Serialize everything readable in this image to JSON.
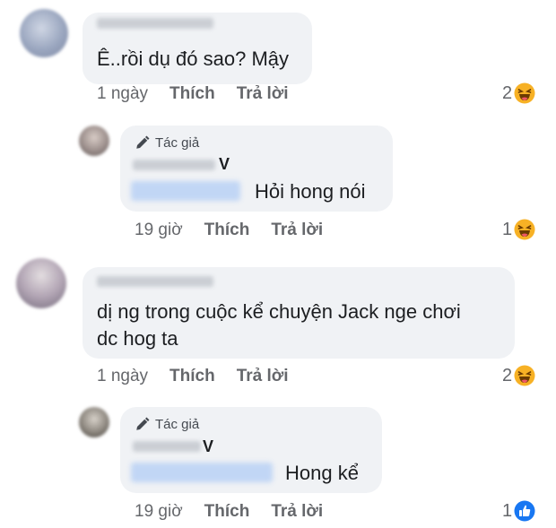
{
  "comments": [
    {
      "text": "Ê..rồi dụ đó sao? Mậy",
      "time": "1 ngày",
      "like": "Thích",
      "reply": "Trả lời",
      "reaction_count": "2",
      "reaction_icon": "haha-emoji-icon"
    },
    {
      "badge": "Tác giả",
      "name_tail": "V",
      "text": "Hỏi hong nói",
      "time": "19 giờ",
      "like": "Thích",
      "reply": "Trả lời",
      "reaction_count": "1",
      "reaction_icon": "haha-emoji-icon"
    },
    {
      "text_line1": "dị ng trong cuộc kể chuyện Jack nge chơi",
      "text_line2": "dc hog ta",
      "time": "1 ngày",
      "like": "Thích",
      "reply": "Trả lời",
      "reaction_count": "2",
      "reaction_icon": "haha-emoji-icon"
    },
    {
      "badge": "Tác giả",
      "name_tail": "V",
      "text": "Hong kể",
      "time": "19 giờ",
      "like": "Thích",
      "reply": "Trả lời",
      "reaction_count": "1",
      "reaction_icon": "like-icon"
    }
  ],
  "colors": {
    "bubble": "#f0f2f5",
    "meta_text": "#65676b",
    "haha_yellow": "#f7b125",
    "like_blue": "#1877f2"
  }
}
